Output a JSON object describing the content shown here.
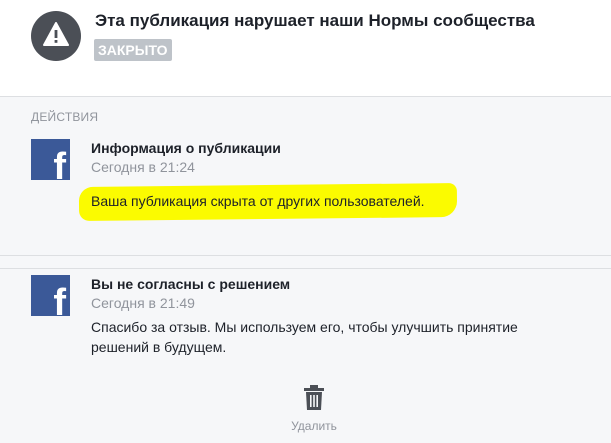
{
  "header": {
    "title": "Эта публикация нарушает наши Нормы сообщества",
    "status_badge": "ЗАКРЫТО"
  },
  "actions": {
    "section_label": "ДЕЙСТВИЯ",
    "items": [
      {
        "title": "Информация о публикации",
        "time": "Сегодня в 21:24",
        "text": "Ваша публикация скрыта от других пользователей."
      },
      {
        "title": "Вы не согласны с решением",
        "time": "Сегодня в 21:49",
        "text": "Спасибо за отзыв. Мы используем его, чтобы улучшить принятие решений в будущем."
      }
    ]
  },
  "footer": {
    "delete_label": "Удалить"
  },
  "colors": {
    "facebook_blue": "#3b5998",
    "highlight_yellow": "#fbfb00",
    "warning_circle": "#4b4f56",
    "badge_gray": "#bec3c9"
  },
  "icons": {
    "warning": "warning-icon",
    "logo": "facebook-logo-icon",
    "delete": "trash-icon"
  }
}
